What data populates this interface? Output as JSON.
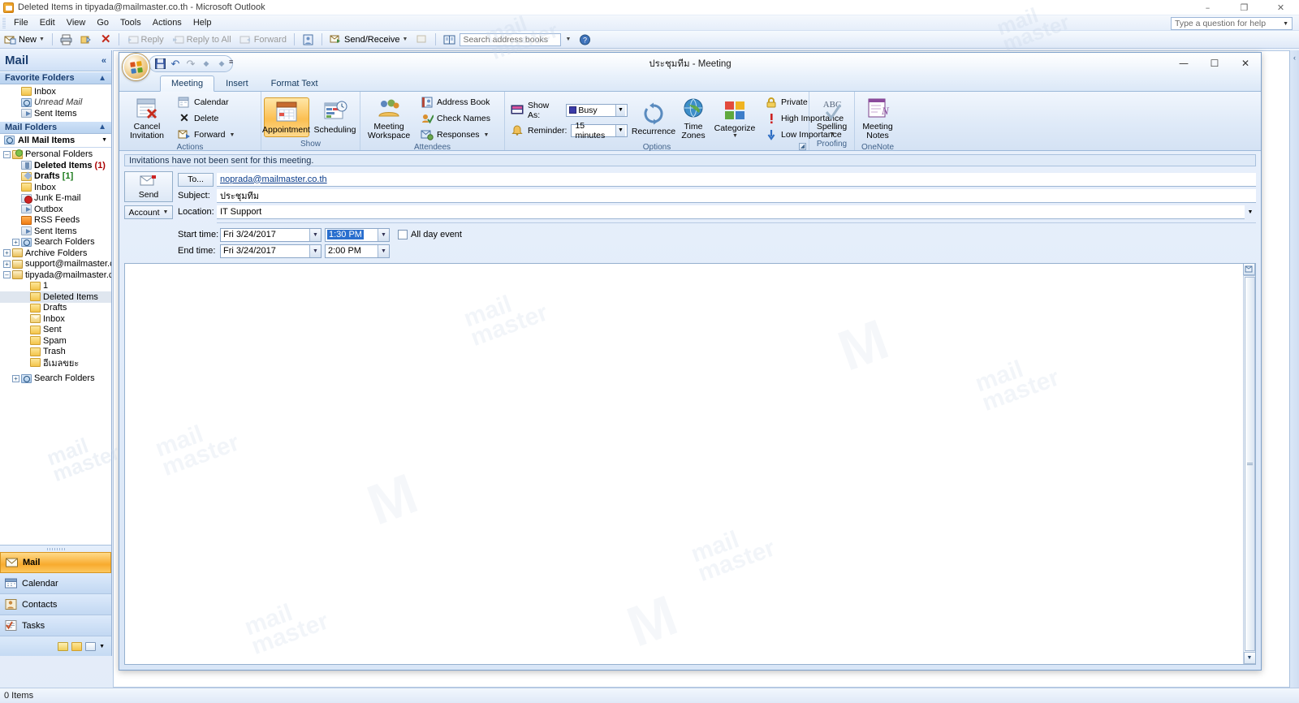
{
  "window": {
    "title": "Deleted Items in tipyada@mailmaster.co.th - Microsoft Outlook",
    "minimize": "–",
    "maximize": "❐",
    "close": "✕"
  },
  "menu": {
    "items": [
      "File",
      "Edit",
      "View",
      "Go",
      "Tools",
      "Actions",
      "Help"
    ],
    "help_placeholder": "Type a question for help"
  },
  "toolbar": {
    "new_label": "New",
    "reply_label": "Reply",
    "reply_all_label": "Reply to All",
    "forward_label": "Forward",
    "send_receive_label": "Send/Receive",
    "search_placeholder": "Search address books"
  },
  "navpane": {
    "title": "Mail",
    "collapse_glyph": "«",
    "favorite_folders": {
      "header": "Favorite Folders",
      "items": [
        {
          "label": "Inbox",
          "icon": "folder-icon",
          "style": "normal"
        },
        {
          "label": "Unread Mail",
          "icon": "search-folder-icon",
          "style": "italic"
        },
        {
          "label": "Sent Items",
          "icon": "sent-folder-icon",
          "style": "normal"
        }
      ]
    },
    "mail_folders": {
      "header": "Mail Folders",
      "all_items_label": "All Mail Items",
      "tree": [
        {
          "label": "Personal Folders",
          "icon": "personal-folders-icon",
          "indent": 0,
          "expander": "-",
          "bold": false
        },
        {
          "label": "Deleted Items",
          "icon": "deleted-items-icon",
          "indent": 1,
          "bold": true,
          "count": "(1)",
          "count_color": "red"
        },
        {
          "label": "Drafts",
          "icon": "drafts-icon",
          "indent": 1,
          "bold": true,
          "count": "[1]",
          "count_color": "green"
        },
        {
          "label": "Inbox",
          "icon": "folder-icon",
          "indent": 1,
          "bold": false
        },
        {
          "label": "Junk E-mail",
          "icon": "junk-folder-icon",
          "indent": 1,
          "bold": false
        },
        {
          "label": "Outbox",
          "icon": "outbox-folder-icon",
          "indent": 1,
          "bold": false
        },
        {
          "label": "RSS Feeds",
          "icon": "rss-folder-icon",
          "indent": 1,
          "bold": false
        },
        {
          "label": "Sent Items",
          "icon": "sent-folder-icon",
          "indent": 1,
          "bold": false
        },
        {
          "label": "Search Folders",
          "icon": "search-folder-icon",
          "indent": 1,
          "expander": "+",
          "bold": false
        },
        {
          "label": "Archive Folders",
          "icon": "archive-folder-icon",
          "indent": 0,
          "expander": "+",
          "bold": false
        },
        {
          "label": "support@mailmaster.co",
          "icon": "archive-folder-icon",
          "indent": 0,
          "expander": "+",
          "bold": false
        },
        {
          "label": "tipyada@mailmaster.co.",
          "icon": "archive-folder-icon",
          "indent": 0,
          "expander": "-",
          "bold": false
        },
        {
          "label": "1",
          "icon": "folder-icon",
          "indent": 2,
          "bold": false
        },
        {
          "label": "Deleted Items",
          "icon": "folder-icon",
          "indent": 2,
          "bold": false,
          "selected": true
        },
        {
          "label": "Drafts",
          "icon": "folder-icon",
          "indent": 2,
          "bold": false
        },
        {
          "label": "Inbox",
          "icon": "envelope-folder-icon",
          "indent": 2,
          "bold": false
        },
        {
          "label": "Sent",
          "icon": "folder-icon",
          "indent": 2,
          "bold": false
        },
        {
          "label": "Spam",
          "icon": "folder-icon",
          "indent": 2,
          "bold": false
        },
        {
          "label": "Trash",
          "icon": "folder-icon",
          "indent": 2,
          "bold": false
        },
        {
          "label": "อีเมลขยะ",
          "icon": "folder-icon",
          "indent": 2,
          "bold": false
        },
        {
          "label": "Search Folders",
          "icon": "search-folder-icon",
          "indent": 1,
          "expander": "+",
          "bold": false
        }
      ]
    },
    "buttons": [
      {
        "label": "Mail",
        "icon": "mail-icon",
        "active": true,
        "color": "#f0a21c"
      },
      {
        "label": "Calendar",
        "icon": "calendar-icon",
        "active": false,
        "color": "#4a7ebb"
      },
      {
        "label": "Contacts",
        "icon": "contacts-icon",
        "active": false,
        "color": "#d2a23a"
      },
      {
        "label": "Tasks",
        "icon": "tasks-icon",
        "active": false,
        "color": "#c7552e"
      }
    ]
  },
  "statusbar": {
    "text": "0 Items"
  },
  "meeting": {
    "title": "ประชุมทีม - Meeting",
    "minimize": "—",
    "maximize": "☐",
    "close": "✕",
    "quick_access": [
      "save-icon",
      "undo-icon",
      "redo-icon",
      "previous-item-icon",
      "next-item-icon"
    ],
    "qat_more": "≡",
    "tabs": [
      {
        "label": "Meeting",
        "active": true
      },
      {
        "label": "Insert",
        "active": false
      },
      {
        "label": "Format Text",
        "active": false
      }
    ],
    "ribbon": {
      "groups": [
        {
          "name": "Actions",
          "big": [
            {
              "label": "Cancel\nInvitation",
              "icon": "cancel-invitation-icon"
            }
          ],
          "small": [
            {
              "label": "Calendar",
              "icon": "calendar-icon"
            },
            {
              "label": "Delete",
              "icon": "delete-icon"
            },
            {
              "label": "Forward",
              "icon": "forward-icon",
              "dropdown": true
            }
          ]
        },
        {
          "name": "Show",
          "big": [
            {
              "label": "Appointment",
              "icon": "appointment-icon",
              "selected": true
            },
            {
              "label": "Scheduling",
              "icon": "scheduling-icon"
            }
          ],
          "small": []
        },
        {
          "name": "Attendees",
          "big": [
            {
              "label": "Meeting\nWorkspace",
              "icon": "meeting-workspace-icon"
            }
          ],
          "small": [
            {
              "label": "Address Book",
              "icon": "address-book-icon"
            },
            {
              "label": "Check Names",
              "icon": "check-names-icon"
            },
            {
              "label": "Responses",
              "icon": "responses-icon",
              "dropdown": true
            }
          ]
        },
        {
          "name": "Options",
          "show_as_label": "Show As:",
          "show_as_value": "Busy",
          "reminder_label": "Reminder:",
          "reminder_value": "15 minutes",
          "big": [
            {
              "label": "Recurrence",
              "icon": "recurrence-icon"
            },
            {
              "label": "Time\nZones",
              "icon": "time-zones-icon"
            },
            {
              "label": "Categorize",
              "icon": "categorize-icon",
              "dropdown": true
            }
          ],
          "small": [
            {
              "label": "Private",
              "icon": "private-lock-icon"
            },
            {
              "label": "High Importance",
              "icon": "high-importance-icon"
            },
            {
              "label": "Low Importance",
              "icon": "low-importance-icon"
            }
          ]
        },
        {
          "name": "Proofing",
          "big": [
            {
              "label": "Spelling",
              "icon": "spelling-icon",
              "dropdown": true
            }
          ],
          "small": []
        },
        {
          "name": "OneNote",
          "big": [
            {
              "label": "Meeting\nNotes",
              "icon": "meeting-notes-icon"
            }
          ],
          "small": []
        }
      ]
    },
    "form": {
      "info_bar": "Invitations have not been sent for this meeting.",
      "send_label": "Send",
      "account_label": "Account",
      "to_button": "To...",
      "to_value": "noprada@mailmaster.co.th",
      "subject_label": "Subject:",
      "subject_value": "ประชุมทีม",
      "location_label": "Location:",
      "location_value": "IT Support",
      "start_time_label": "Start time:",
      "start_date": "Fri 3/24/2017",
      "start_clock": "1:30 PM",
      "end_time_label": "End time:",
      "end_date": "Fri 3/24/2017",
      "end_clock": "2:00 PM",
      "all_day_label": "All day event",
      "all_day_checked": false,
      "body_value": ""
    }
  },
  "watermark": {
    "line1": "mail",
    "line2": "master",
    "logo": "M"
  }
}
